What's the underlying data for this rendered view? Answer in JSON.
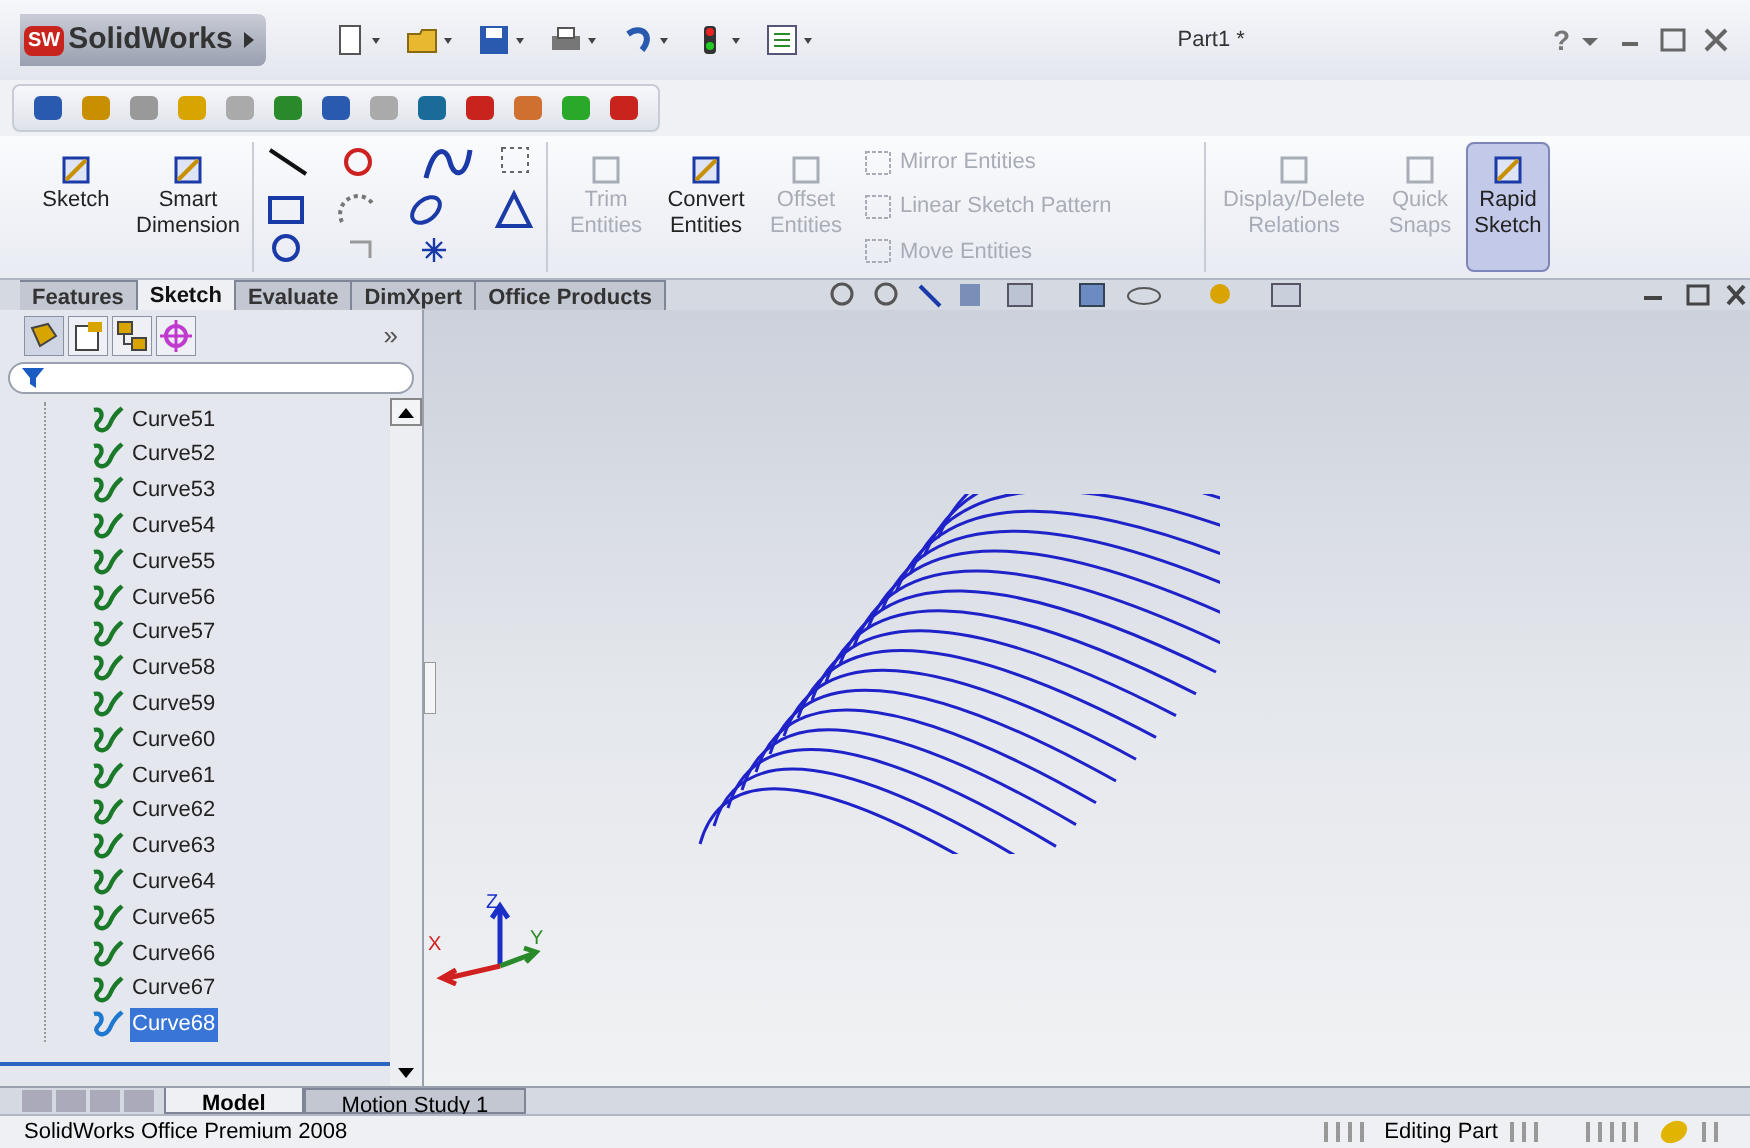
{
  "title_bar": {
    "logo": "SW",
    "app_name": "SolidWorks",
    "document_title": "Part1 *",
    "help": "?"
  },
  "command_manager": {
    "large_tools": [
      {
        "label": "Sketch",
        "disabled": false,
        "on": false
      },
      {
        "label": "Smart Dimension",
        "disabled": false,
        "on": false
      }
    ],
    "mid_tools": [
      {
        "label": "Trim Entities",
        "disabled": true,
        "on": false
      },
      {
        "label": "Convert Entities",
        "disabled": false,
        "on": false
      },
      {
        "label": "Offset Entities",
        "disabled": true,
        "on": false
      }
    ],
    "list_tools": [
      {
        "label": "Mirror Entities",
        "disabled": true
      },
      {
        "label": "Linear Sketch Pattern",
        "disabled": true
      },
      {
        "label": "Move Entities",
        "disabled": true
      }
    ],
    "right_tools": [
      {
        "label": "Display/Delete Relations",
        "disabled": true,
        "on": false
      },
      {
        "label": "Quick Snaps",
        "disabled": true,
        "on": false
      },
      {
        "label": "Rapid Sketch",
        "disabled": false,
        "on": true
      }
    ]
  },
  "tabs": [
    {
      "label": "Features",
      "selected": false
    },
    {
      "label": "Sketch",
      "selected": true
    },
    {
      "label": "Evaluate",
      "selected": false
    },
    {
      "label": "DimXpert",
      "selected": false
    },
    {
      "label": "Office Products",
      "selected": false
    }
  ],
  "panel": {
    "more": "»",
    "tree": [
      {
        "label": "Curve51",
        "selected": false
      },
      {
        "label": "Curve52",
        "selected": false
      },
      {
        "label": "Curve53",
        "selected": false
      },
      {
        "label": "Curve54",
        "selected": false
      },
      {
        "label": "Curve55",
        "selected": false
      },
      {
        "label": "Curve56",
        "selected": false
      },
      {
        "label": "Curve57",
        "selected": false
      },
      {
        "label": "Curve58",
        "selected": false
      },
      {
        "label": "Curve59",
        "selected": false
      },
      {
        "label": "Curve60",
        "selected": false
      },
      {
        "label": "Curve61",
        "selected": false
      },
      {
        "label": "Curve62",
        "selected": false
      },
      {
        "label": "Curve63",
        "selected": false
      },
      {
        "label": "Curve64",
        "selected": false
      },
      {
        "label": "Curve65",
        "selected": false
      },
      {
        "label": "Curve66",
        "selected": false
      },
      {
        "label": "Curve67",
        "selected": false
      },
      {
        "label": "Curve68",
        "selected": true
      }
    ]
  },
  "triad": {
    "x": "X",
    "y": "Y",
    "z": "Z"
  },
  "bottom_tabs": [
    {
      "label": "Model",
      "selected": true
    },
    {
      "label": "Motion Study 1",
      "selected": false
    }
  ],
  "status_bar": {
    "product": "SolidWorks Office Premium 2008",
    "mode": "Editing Part"
  }
}
